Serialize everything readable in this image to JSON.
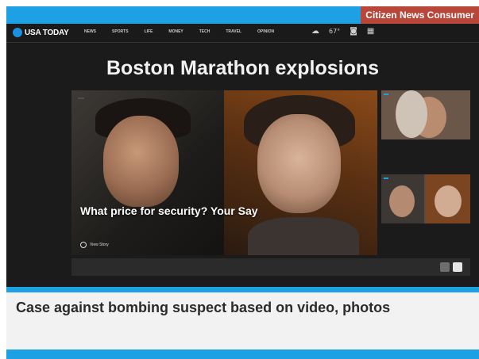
{
  "brand_tag": "Citizen News Consumer",
  "site": {
    "logo_text": "USA TODAY",
    "nav_items": [
      "NEWS",
      "SPORTS",
      "LIFE",
      "MONEY",
      "TECH",
      "TRAVEL",
      "OPINION"
    ],
    "weather": "67°"
  },
  "page": {
    "headline": "Boston Marathon explosions",
    "main_photo": {
      "tag": "",
      "overlay_title": "What price for security? Your Say",
      "overlay_desc": "",
      "view_story": "View Story"
    },
    "side_stories": [
      {
        "tag": "",
        "text": ""
      },
      {
        "tag": "",
        "text": ""
      }
    ],
    "bottom_bar": {
      "label": "",
      "buttons": [
        "",
        ""
      ]
    }
  },
  "article": {
    "title": "Case against bombing suspect based on video, photos",
    "byline": ""
  },
  "colors": {
    "accent_blue": "#1ea0e4",
    "brand_red": "#b8473a"
  }
}
